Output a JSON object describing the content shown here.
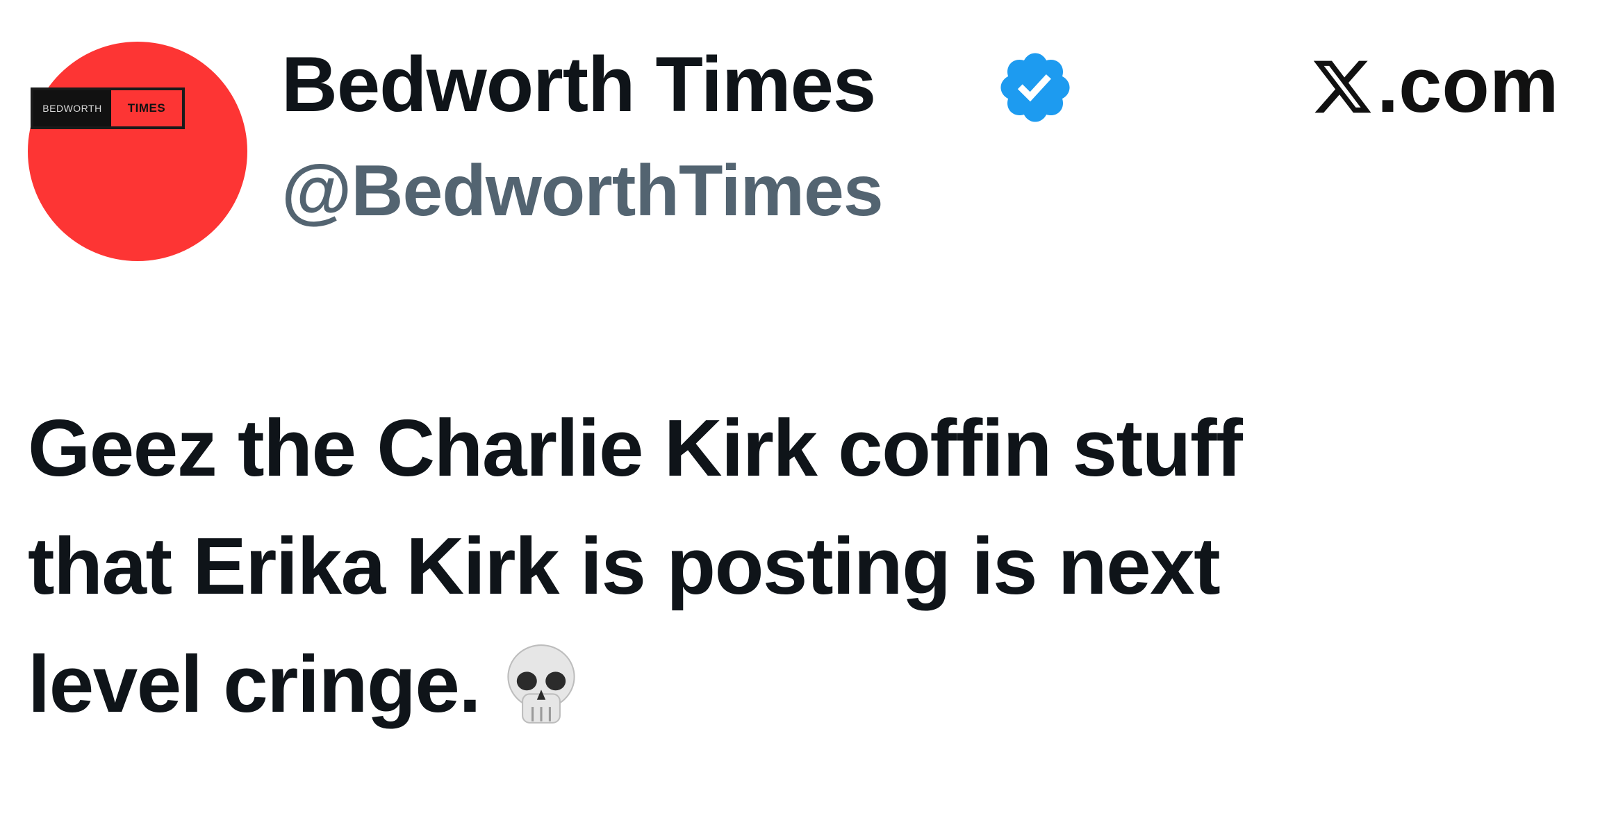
{
  "account": {
    "display_name": "Bedworth Times",
    "handle": "@BedworthTimes",
    "verified": true,
    "avatar_logo_left": "BEDWORTH",
    "avatar_logo_right": "TIMES",
    "avatar_color": "#fd3534"
  },
  "brand": {
    "site_label": ".com",
    "logo_icon": "x-logo-icon"
  },
  "tweet": {
    "lines": [
      "Geez the Charlie Kirk coffin stuff",
      "that Erika Kirk is posting is next",
      "level cringe."
    ],
    "emoji_icon": "skull-icon"
  },
  "colors": {
    "text_primary": "#0f1419",
    "text_secondary": "#536471",
    "verified_blue": "#1d9bf0"
  }
}
